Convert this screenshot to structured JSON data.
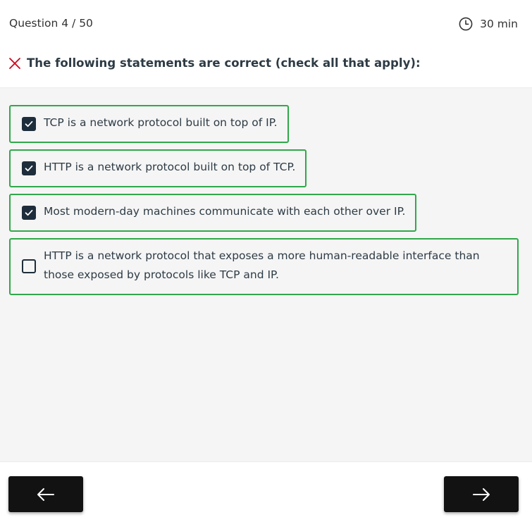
{
  "header": {
    "counter": "Question 4 / 50",
    "timer": "30 min",
    "timer_icon": "clock-icon"
  },
  "question": {
    "status_icon": "incorrect-x-icon",
    "status_color": "#d0021b",
    "text": "The following statements are correct (check all that apply):"
  },
  "options": [
    {
      "label": "TCP is a network protocol built on top of IP.",
      "checked": true
    },
    {
      "label": "HTTP is a network protocol built on top of TCP.",
      "checked": true
    },
    {
      "label": "Most modern-day machines communicate with each other over IP.",
      "checked": true
    },
    {
      "label": "HTTP is a network protocol that exposes a more human-readable interface than those exposed by protocols like TCP and IP.",
      "checked": false
    }
  ],
  "colors": {
    "correct_border": "#30a84a",
    "checkbox": "#1e2d3b",
    "button": "#121212"
  },
  "footer": {
    "prev_icon": "arrow-left-icon",
    "next_icon": "arrow-right-icon"
  }
}
